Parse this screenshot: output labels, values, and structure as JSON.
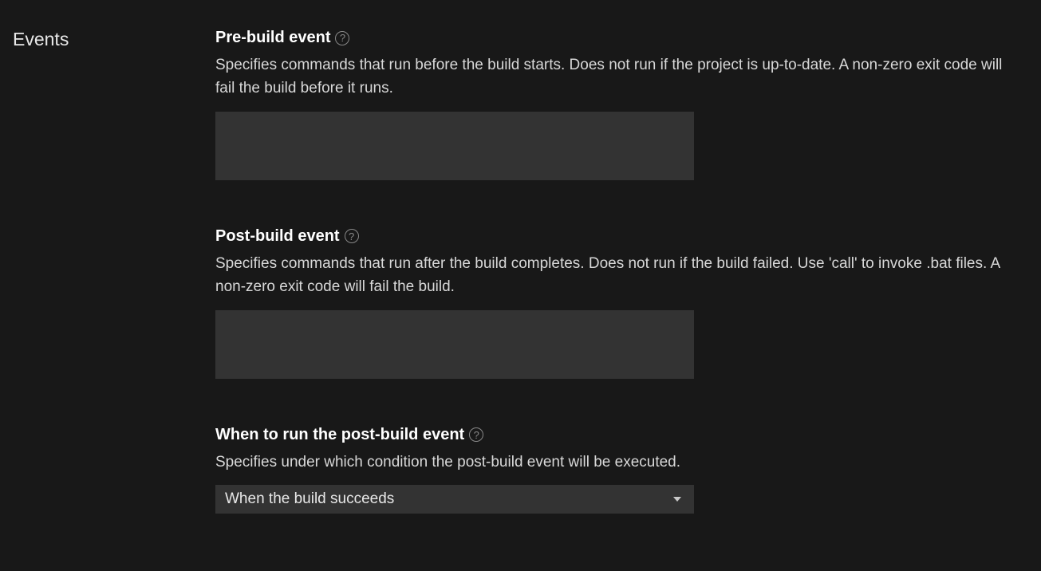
{
  "sidebar": {
    "section_title": "Events"
  },
  "settings": {
    "pre_build": {
      "title": "Pre-build event",
      "description": "Specifies commands that run before the build starts. Does not run if the project is up-to-date. A non-zero exit code will fail the build before it runs.",
      "value": ""
    },
    "post_build": {
      "title": "Post-build event",
      "description": "Specifies commands that run after the build completes. Does not run if the build failed. Use 'call' to invoke .bat files. A non-zero exit code will fail the build.",
      "value": ""
    },
    "post_build_condition": {
      "title": "When to run the post-build event",
      "description": "Specifies under which condition the post-build event will be executed.",
      "selected": "When the build succeeds"
    }
  },
  "help_glyph": "?"
}
